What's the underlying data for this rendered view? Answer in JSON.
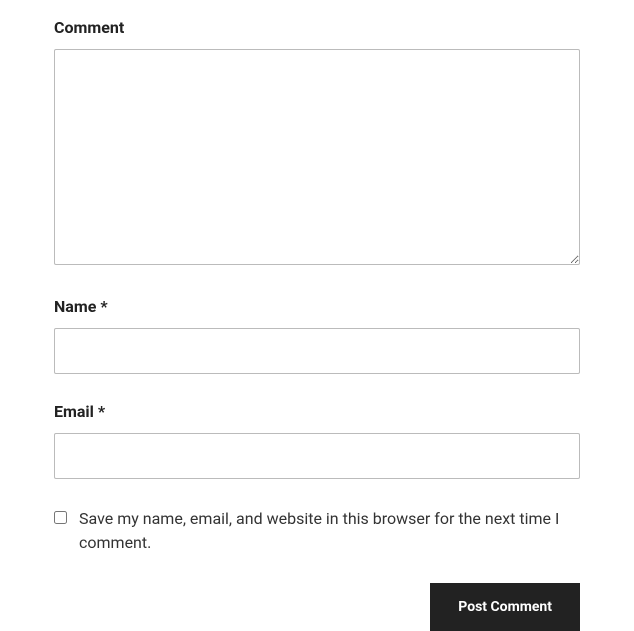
{
  "form": {
    "comment": {
      "label": "Comment",
      "value": ""
    },
    "name": {
      "label": "Name ",
      "required": "*",
      "value": ""
    },
    "email": {
      "label": "Email ",
      "required": "*",
      "value": ""
    },
    "save_info": {
      "label": "Save my name, email, and website in this browser for the next time I comment.",
      "checked": false
    },
    "submit": {
      "label": "Post Comment"
    }
  }
}
